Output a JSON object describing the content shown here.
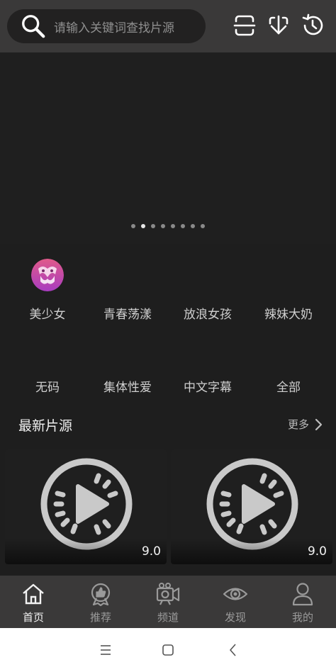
{
  "header": {
    "search_placeholder": "请输入关键词查找片源",
    "icons": [
      "search-icon",
      "scan-icon",
      "download-icon",
      "history-icon"
    ]
  },
  "banner": {
    "slide_count": 8,
    "active_index": 1
  },
  "categories": [
    {
      "label": "美少女"
    },
    {
      "label": "青春荡漾"
    },
    {
      "label": "放浪女孩"
    },
    {
      "label": "辣妹大奶"
    },
    {
      "label": "无码"
    },
    {
      "label": "集体性爱"
    },
    {
      "label": "中文字幕"
    },
    {
      "label": "全部"
    }
  ],
  "latest": {
    "title": "最新片源",
    "more_label": "更多",
    "items": [
      {
        "score": "9.0"
      },
      {
        "score": "9.0"
      }
    ]
  },
  "bottom_nav": {
    "items": [
      {
        "label": "首页",
        "icon": "home-icon",
        "active": true
      },
      {
        "label": "推荐",
        "icon": "thumbs-up-badge-icon",
        "active": false
      },
      {
        "label": "频道",
        "icon": "video-camera-icon",
        "active": false
      },
      {
        "label": "发现",
        "icon": "eye-icon",
        "active": false
      },
      {
        "label": "我的",
        "icon": "user-icon",
        "active": false
      }
    ]
  },
  "system_nav": {
    "icons": [
      "menu-icon",
      "home-square-icon",
      "back-icon"
    ]
  },
  "colors": {
    "background": "#1e1e1e",
    "header_bar": "#3a3939",
    "search_bg": "#222121",
    "accent_avatar": "#c24aa8"
  }
}
